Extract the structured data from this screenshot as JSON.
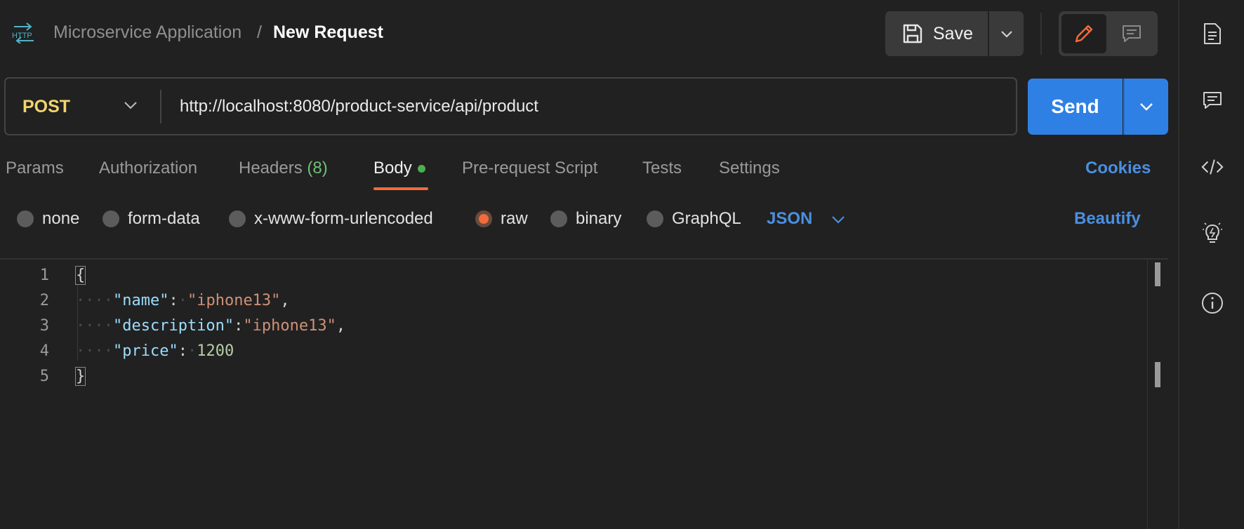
{
  "header": {
    "breadcrumb_parent": "Microservice Application",
    "breadcrumb_separator": "/",
    "breadcrumb_current": "New Request",
    "save_label": "Save"
  },
  "request": {
    "method": "POST",
    "url": "http://localhost:8080/product-service/api/product",
    "send_label": "Send"
  },
  "tabs": {
    "params": "Params",
    "authorization": "Authorization",
    "headers": "Headers",
    "headers_count": "(8)",
    "body": "Body",
    "pre_request": "Pre-request Script",
    "tests": "Tests",
    "settings": "Settings",
    "cookies": "Cookies",
    "active": "Body"
  },
  "body_types": {
    "none": "none",
    "form_data": "form-data",
    "urlencoded": "x-www-form-urlencoded",
    "raw": "raw",
    "binary": "binary",
    "graphql": "GraphQL",
    "selected": "raw",
    "language": "JSON",
    "beautify": "Beautify"
  },
  "editor": {
    "line_numbers": [
      "1",
      "2",
      "3",
      "4",
      "5"
    ],
    "lines": {
      "open": "{",
      "name_key": "\"name\"",
      "name_value": "\"iphone13\"",
      "desc_key": "\"description\"",
      "desc_value": "\"iphone13\"",
      "price_key": "\"price\"",
      "price_value": "1200",
      "close": "}"
    }
  },
  "colors": {
    "accent_orange": "#f26b3a",
    "send_blue": "#2f80e4",
    "link_blue": "#4b8fe0",
    "method_yellow": "#f2d56b",
    "indicator_green": "#4caf50"
  },
  "icons": {
    "protocol": "http-icon",
    "save": "floppy-disk-icon",
    "edit": "pencil-icon",
    "comment": "comment-icon",
    "rail": [
      "document-icon",
      "comment-icon",
      "code-icon",
      "lightbulb-icon",
      "info-icon"
    ]
  }
}
